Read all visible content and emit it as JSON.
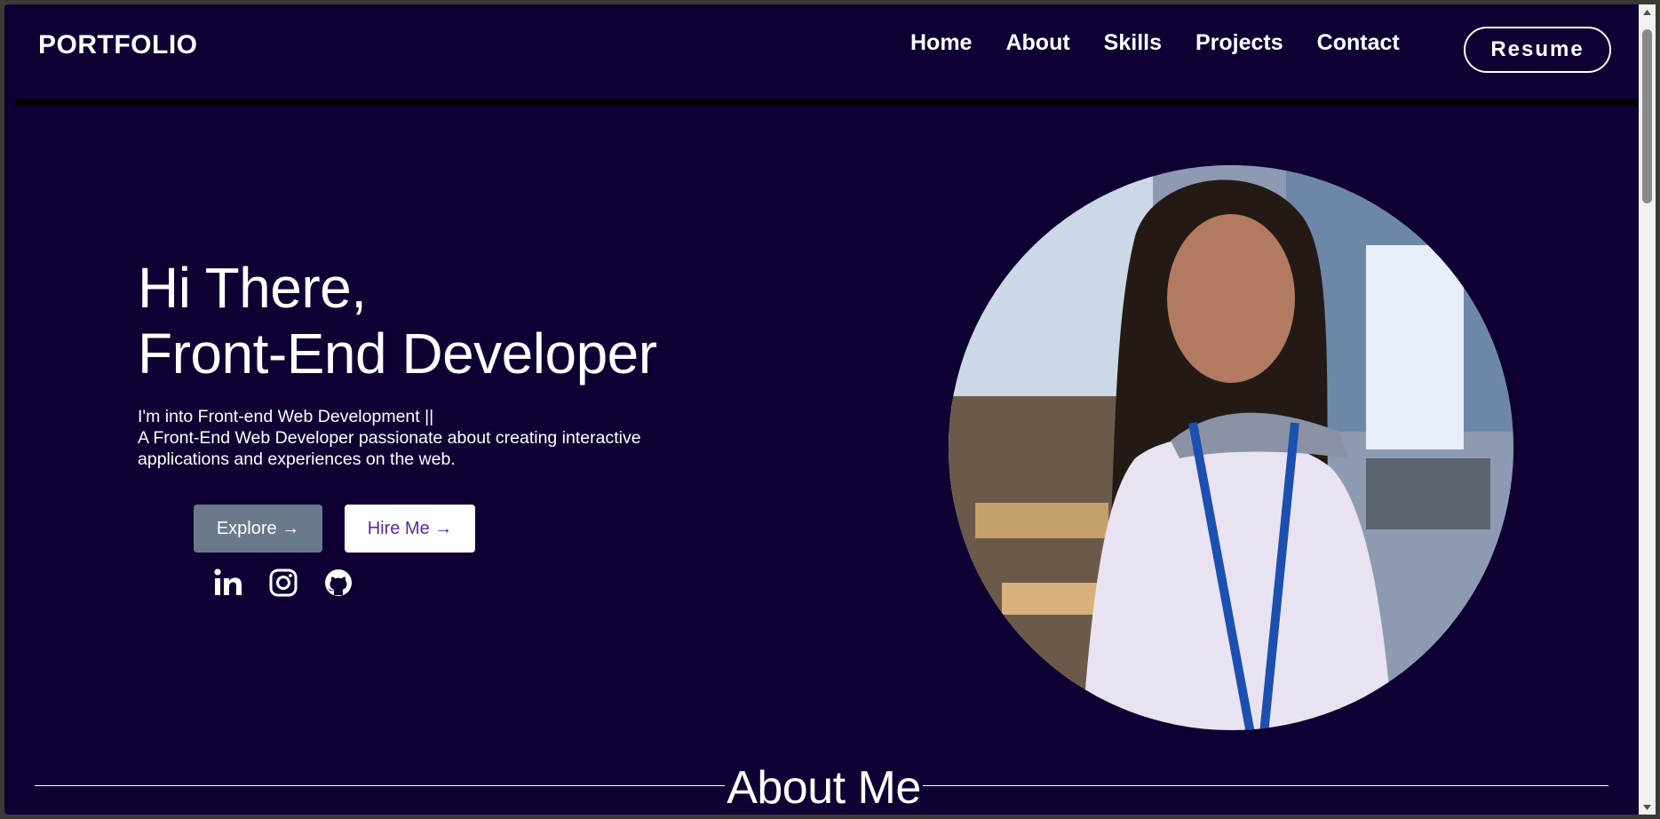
{
  "header": {
    "logo": "PORTFOLIO",
    "nav": [
      "Home",
      "About",
      "Skills",
      "Projects",
      "Contact"
    ],
    "resume_label": "Resume"
  },
  "hero": {
    "title_line1": "Hi There,",
    "title_line2": "Front-End Developer",
    "tagline": "I'm into Front-end Web Development ||",
    "description_line1": "A Front-End Web Developer passionate about creating interactive",
    "description_line2": "applications and experiences on the web.",
    "explore_label": "Explore →",
    "hire_label": "Hire Me →",
    "socials": [
      "linkedin-icon",
      "instagram-icon",
      "github-icon"
    ]
  },
  "about": {
    "heading": "About Me"
  },
  "colors": {
    "background": "#0f0033",
    "explore_button": "#6a7a8a",
    "hire_text": "#5a2a9a"
  }
}
